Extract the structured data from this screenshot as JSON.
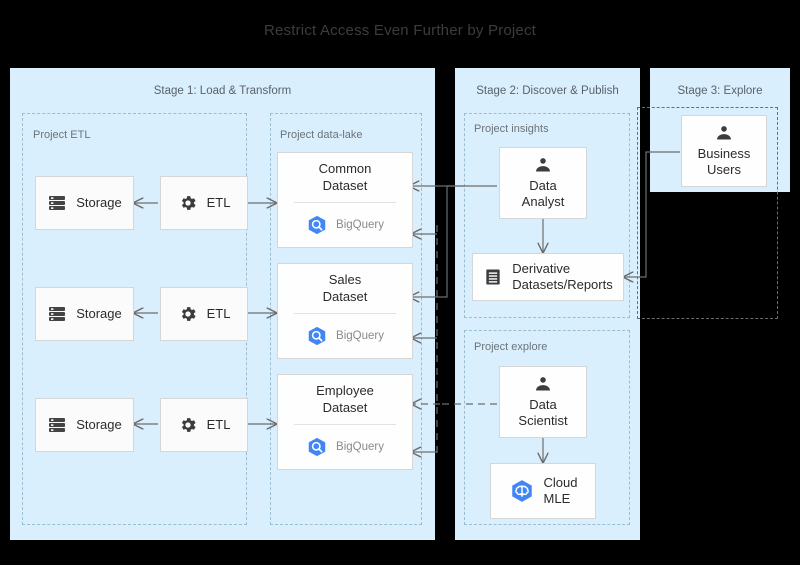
{
  "title": "Restrict Access Even Further by Project",
  "colors": {
    "panel_bg": "#daeffd",
    "card_bg": "#fbfbfb",
    "card_border": "#d6d6d6",
    "dash_border": "#9bbdd4",
    "connector": "#6d6d6d",
    "bigquery_blue": "#4285f4",
    "title_text": "#3c3c3c",
    "label_text": "#5a6268"
  },
  "stages": [
    {
      "id": "stage1",
      "label": "Stage 1: Load & Transform"
    },
    {
      "id": "stage2",
      "label": "Stage 2: Discover & Publish"
    },
    {
      "id": "stage3",
      "label": "Stage 3: Explore"
    }
  ],
  "projects": [
    {
      "id": "etl",
      "label": "Project ETL"
    },
    {
      "id": "datalake",
      "label": "Project data-lake"
    },
    {
      "id": "insights",
      "label": "Project insights"
    },
    {
      "id": "explore",
      "label": "Project explore"
    }
  ],
  "storage_nodes": [
    {
      "label": "Storage",
      "icon": "storage-icon"
    },
    {
      "label": "Storage",
      "icon": "storage-icon"
    },
    {
      "label": "Storage",
      "icon": "storage-icon"
    }
  ],
  "etl_nodes": [
    {
      "label": "ETL",
      "icon": "gear-icon"
    },
    {
      "label": "ETL",
      "icon": "gear-icon"
    },
    {
      "label": "ETL",
      "icon": "gear-icon"
    }
  ],
  "datasets": [
    {
      "title": "Common Dataset",
      "line1": "Common",
      "line2": "Dataset",
      "service": "BigQuery",
      "icon": "bigquery-icon"
    },
    {
      "title": "Sales Dataset",
      "line1": "Sales",
      "line2": "Dataset",
      "service": "BigQuery",
      "icon": "bigquery-icon"
    },
    {
      "title": "Employee Dataset",
      "line1": "Employee",
      "line2": "Dataset",
      "service": "BigQuery",
      "icon": "bigquery-icon"
    }
  ],
  "actors": {
    "data_analyst": {
      "line1": "Data",
      "line2": "Analyst",
      "icon": "person-icon"
    },
    "data_scientist": {
      "line1": "Data",
      "line2": "Scientist",
      "icon": "person-icon"
    },
    "business_users": {
      "line1": "Business",
      "line2": "Users",
      "icon": "person-icon"
    }
  },
  "outputs": {
    "derivative": {
      "line1": "Derivative",
      "line2": "Datasets/Reports",
      "icon": "report-icon"
    },
    "cloud_mle": {
      "line1": "Cloud",
      "line2": "MLE",
      "icon": "cloud-mle-icon"
    }
  }
}
